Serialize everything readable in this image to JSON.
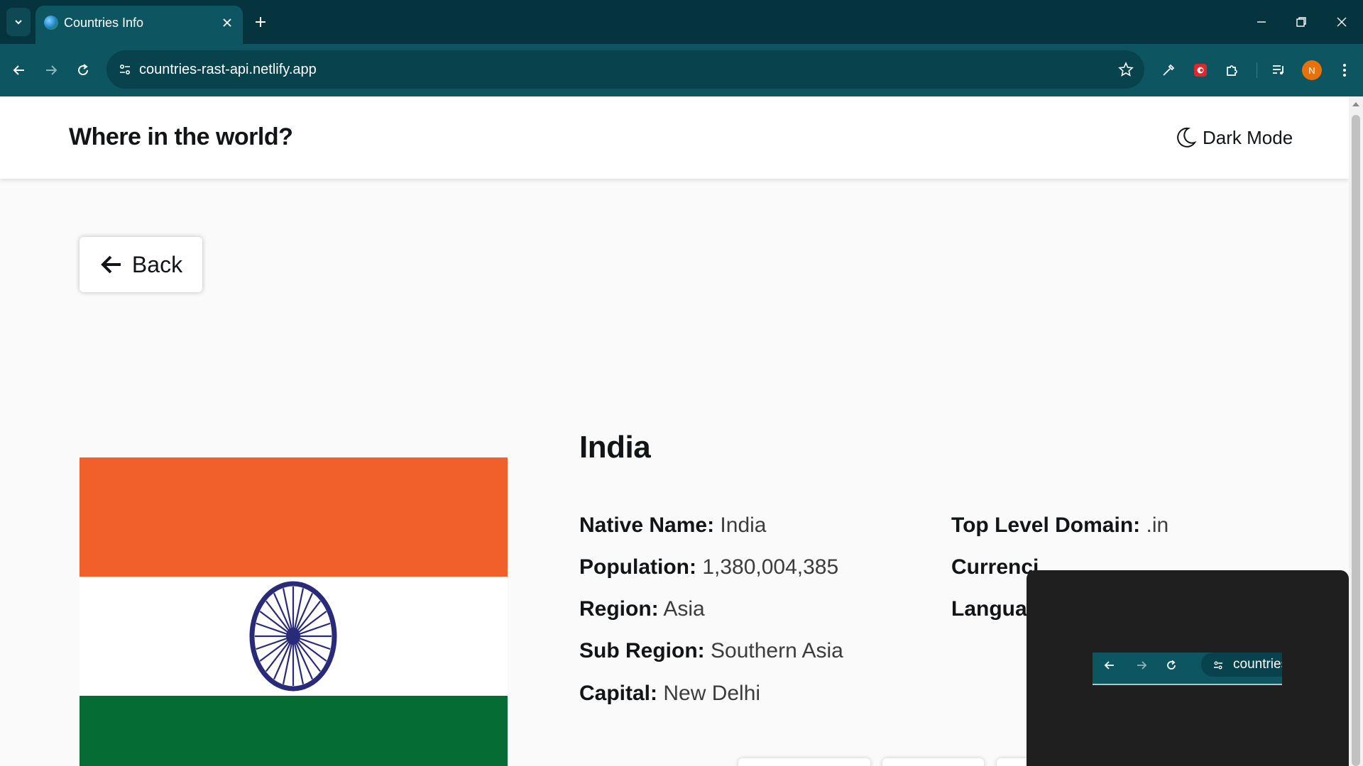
{
  "browser": {
    "tab_title": "Countries Info",
    "url": "countries-rast-api.netlify.app",
    "avatar_initial": "N",
    "accent_color": "#0d5560",
    "tabbar_color": "#05343e"
  },
  "header": {
    "title": "Where in the world?",
    "dark_mode_label": "Dark Mode",
    "dark_mode_icon": "moon-icon"
  },
  "back_button": {
    "label": "Back",
    "icon": "arrow-left-icon"
  },
  "country": {
    "name": "India",
    "flag_colors": {
      "saffron": "#f15f2a",
      "white": "#ffffff",
      "green": "#056c34",
      "chakra": "#2a2a7a"
    },
    "left_fields": [
      {
        "label": "Native Name:",
        "value": "India"
      },
      {
        "label": "Population:",
        "value": "1,380,004,385"
      },
      {
        "label": "Region:",
        "value": "Asia"
      },
      {
        "label": "Sub Region:",
        "value": "Southern Asia"
      },
      {
        "label": "Capital:",
        "value": "New Delhi"
      }
    ],
    "right_fields": [
      {
        "label": "Top Level Domain:",
        "value": ".in"
      },
      {
        "label": "Currenci",
        "value": ""
      },
      {
        "label": "Languag",
        "value": ""
      }
    ]
  },
  "overlay": {
    "mini_url": "countries"
  }
}
